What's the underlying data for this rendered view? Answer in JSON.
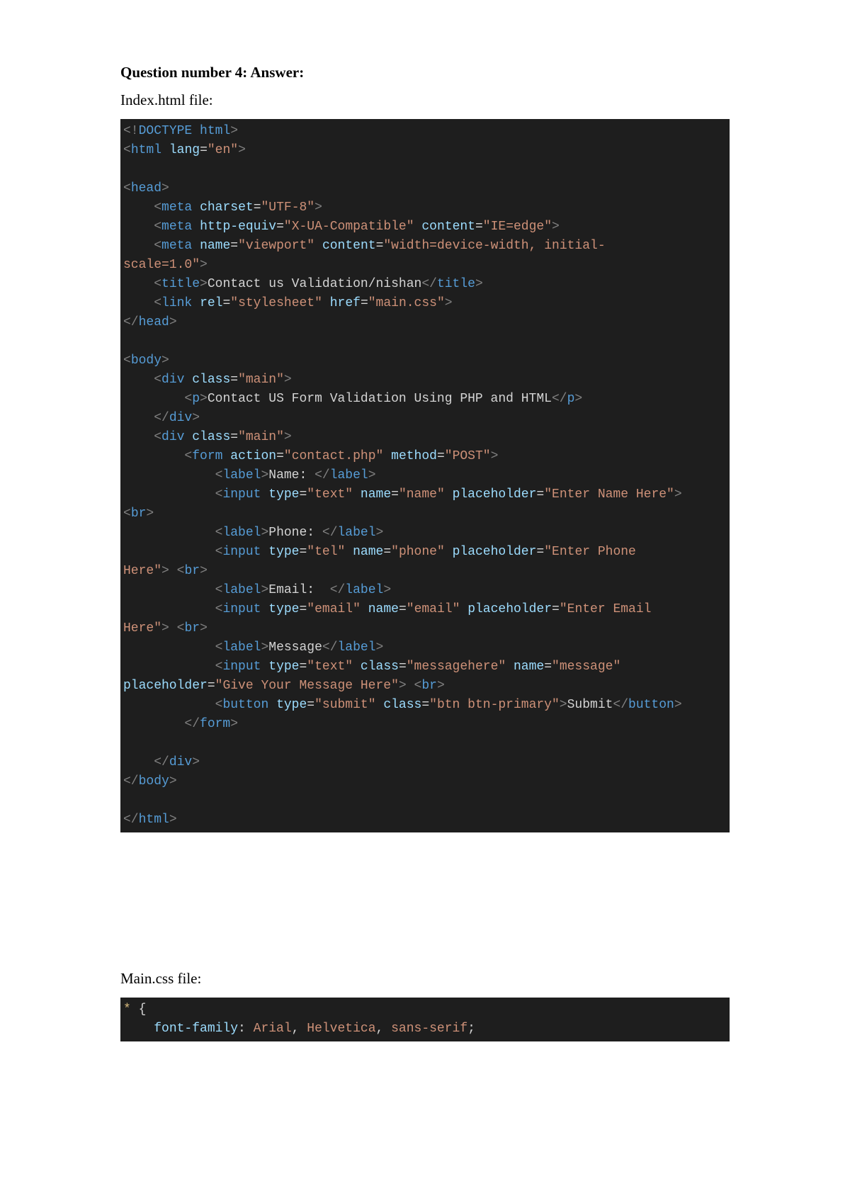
{
  "heading": "Question number 4: Answer:",
  "label_index": "Index.html file:",
  "label_main": "Main.css file:",
  "code1": {
    "l1": {
      "a": "<!",
      "b": "DOCTYPE",
      "c": " ",
      "d": "html",
      "e": ">"
    },
    "l2": {
      "a": "<",
      "b": "html",
      "c": " ",
      "d": "lang",
      "e": "=",
      "f": "\"en\"",
      "g": ">"
    },
    "l3": "",
    "l4": {
      "a": "<",
      "b": "head",
      "c": ">"
    },
    "l5": {
      "pad": "    ",
      "a": "<",
      "b": "meta",
      "c": " ",
      "d": "charset",
      "e": "=",
      "f": "\"UTF-8\"",
      "g": ">"
    },
    "l6": {
      "pad": "    ",
      "a": "<",
      "b": "meta",
      "c": " ",
      "d": "http-equiv",
      "e": "=",
      "f": "\"X-UA-Compatible\"",
      "g": " ",
      "h": "content",
      "i": "=",
      "j": "\"IE=edge\"",
      "k": ">"
    },
    "l7a": {
      "pad": "    ",
      "a": "<",
      "b": "meta",
      "c": " ",
      "d": "name",
      "e": "=",
      "f": "\"viewport\"",
      "g": " ",
      "h": "content",
      "i": "=",
      "j": "\"width=device-width, initial-"
    },
    "l7b": {
      "a": "scale=1.0\"",
      "b": ">"
    },
    "l8": {
      "pad": "    ",
      "a": "<",
      "b": "title",
      "c": ">",
      "d": "Contact us Validation/nishan",
      "e": "</",
      "f": "title",
      "g": ">"
    },
    "l9": {
      "pad": "    ",
      "a": "<",
      "b": "link",
      "c": " ",
      "d": "rel",
      "e": "=",
      "f": "\"stylesheet\"",
      "g": " ",
      "h": "href",
      "i": "=",
      "j": "\"main.css\"",
      "k": ">"
    },
    "l10": {
      "a": "</",
      "b": "head",
      "c": ">"
    },
    "l11": "",
    "l12": {
      "a": "<",
      "b": "body",
      "c": ">"
    },
    "l13": {
      "pad": "    ",
      "a": "<",
      "b": "div",
      "c": " ",
      "d": "class",
      "e": "=",
      "f": "\"main\"",
      "g": ">"
    },
    "l14": {
      "pad": "        ",
      "a": "<",
      "b": "p",
      "c": ">",
      "d": "Contact US Form Validation Using PHP and HTML",
      "e": "</",
      "f": "p",
      "g": ">"
    },
    "l15": {
      "pad": "    ",
      "a": "</",
      "b": "div",
      "c": ">"
    },
    "l16": {
      "pad": "    ",
      "a": "<",
      "b": "div",
      "c": " ",
      "d": "class",
      "e": "=",
      "f": "\"main\"",
      "g": ">"
    },
    "l17": {
      "pad": "        ",
      "a": "<",
      "b": "form",
      "c": " ",
      "d": "action",
      "e": "=",
      "f": "\"contact.php\"",
      "g": " ",
      "h": "method",
      "i": "=",
      "j": "\"POST\"",
      "k": ">"
    },
    "l18": {
      "pad": "            ",
      "a": "<",
      "b": "label",
      "c": ">",
      "d": "Name: ",
      "e": "</",
      "f": "label",
      "g": ">"
    },
    "l19": {
      "pad": "            ",
      "a": "<",
      "b": "input",
      "c": " ",
      "d": "type",
      "e": "=",
      "f": "\"text\"",
      "g": " ",
      "h": "name",
      "i": "=",
      "j": "\"name\"",
      "k": " ",
      "l": "placeholder",
      "m": "=",
      "n": "\"Enter Name Here\"",
      "o": ">"
    },
    "l20": {
      "a": "<",
      "b": "br",
      "c": ">"
    },
    "l21": {
      "pad": "            ",
      "a": "<",
      "b": "label",
      "c": ">",
      "d": "Phone: ",
      "e": "</",
      "f": "label",
      "g": ">"
    },
    "l22a": {
      "pad": "            ",
      "a": "<",
      "b": "input",
      "c": " ",
      "d": "type",
      "e": "=",
      "f": "\"tel\"",
      "g": " ",
      "h": "name",
      "i": "=",
      "j": "\"phone\"",
      "k": " ",
      "l": "placeholder",
      "m": "=",
      "n": "\"Enter Phone "
    },
    "l22b": {
      "a": "Here\"",
      "b": ">",
      "c": " ",
      "d": "<",
      "e": "br",
      "f": ">"
    },
    "l23": {
      "pad": "            ",
      "a": "<",
      "b": "label",
      "c": ">",
      "d": "Email:  ",
      "e": "</",
      "f": "label",
      "g": ">"
    },
    "l24a": {
      "pad": "            ",
      "a": "<",
      "b": "input",
      "c": " ",
      "d": "type",
      "e": "=",
      "f": "\"email\"",
      "g": " ",
      "h": "name",
      "i": "=",
      "j": "\"email\"",
      "k": " ",
      "l": "placeholder",
      "m": "=",
      "n": "\"Enter Email "
    },
    "l24b": {
      "a": "Here\"",
      "b": ">",
      "c": " ",
      "d": "<",
      "e": "br",
      "f": ">"
    },
    "l25": {
      "pad": "            ",
      "a": "<",
      "b": "label",
      "c": ">",
      "d": "Message",
      "e": "</",
      "f": "label",
      "g": ">"
    },
    "l26a": {
      "pad": "            ",
      "a": "<",
      "b": "input",
      "c": " ",
      "d": "type",
      "e": "=",
      "f": "\"text\"",
      "g": " ",
      "h": "class",
      "i": "=",
      "j": "\"messagehere\"",
      "k": " ",
      "l": "name",
      "m": "=",
      "n": "\"message\""
    },
    "l26b": {
      "a": "placeholder",
      "b": "=",
      "c": "\"Give Your Message Here\"",
      "d": ">",
      "e": " ",
      "f": "<",
      "g": "br",
      "h": ">"
    },
    "l27": {
      "pad": "            ",
      "a": "<",
      "b": "button",
      "c": " ",
      "d": "type",
      "e": "=",
      "f": "\"submit\"",
      "g": " ",
      "h": "class",
      "i": "=",
      "j": "\"btn btn-primary\"",
      "k": ">",
      "l": "Submit",
      "m": "</",
      "n": "button",
      "o": ">"
    },
    "l28": {
      "pad": "        ",
      "a": "</",
      "b": "form",
      "c": ">"
    },
    "l29": "",
    "l30": {
      "pad": "    ",
      "a": "</",
      "b": "div",
      "c": ">"
    },
    "l31": {
      "a": "</",
      "b": "body",
      "c": ">"
    },
    "l32": "",
    "l33": {
      "a": "</",
      "b": "html",
      "c": ">"
    }
  },
  "code2": {
    "l1": {
      "a": "*",
      "b": " {"
    },
    "l2": {
      "pad": "    ",
      "a": "font-family",
      "b": ": ",
      "c": "Arial",
      "d": ", ",
      "e": "Helvetica",
      "f": ", ",
      "g": "sans-serif",
      "h": ";"
    }
  }
}
